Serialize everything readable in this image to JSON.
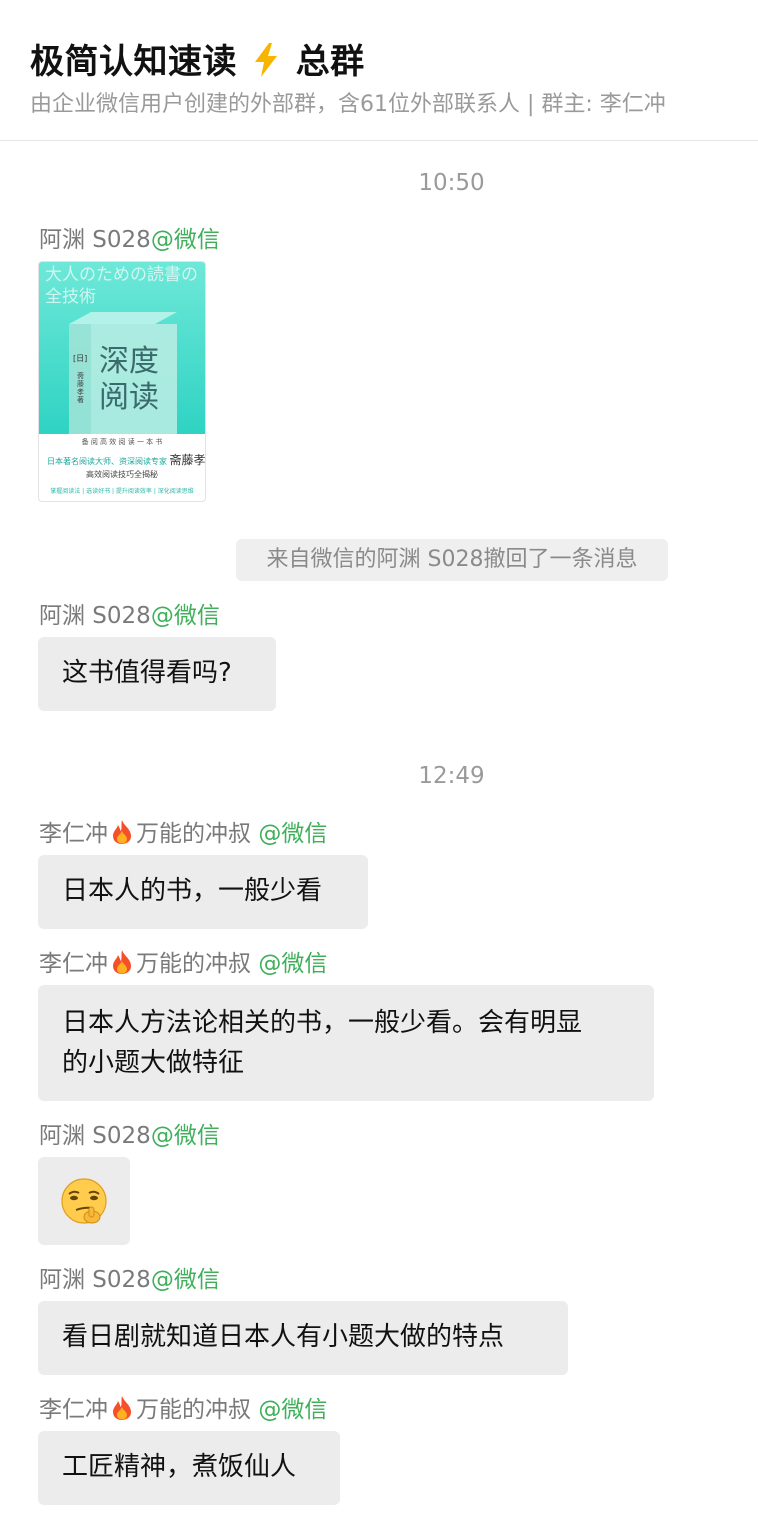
{
  "header": {
    "title": "极简认知速读",
    "title_suffix": "总群",
    "subtitle": "由企业微信用户创建的外部群，含61位外部联系人 | 群主: 李仁冲"
  },
  "times": [
    "10:50",
    "12:49"
  ],
  "names": {
    "ayuan": "阿渊 S028",
    "li": "李仁冲",
    "li_nick": "万能的冲叔",
    "wechat_tag": "@微信"
  },
  "book": {
    "cover_title_line1": "深度",
    "cover_title_line2": "阅读",
    "top_text": "大人のための読書の全技術",
    "country": "[日]",
    "author_small": "斋藤孝 著",
    "tagline": "备 阅 高 效 阅 读 一 本 书",
    "promo": "日本著名阅读大师、资深阅读专家",
    "author_name": "斋藤孝",
    "subtitle": "高效阅读技巧全揭秘",
    "footer": "掌握阅读法 | 选读好书 | 提升阅读效率 | 深化阅读思维"
  },
  "notice": "来自微信的阿渊 S028撤回了一条消息",
  "messages": {
    "m1": "这书值得看吗?",
    "m2": "日本人的书，一般少看",
    "m3_line1": "日本人方法论相关的书，一般少看。会有明显",
    "m3_line2": "的小题大做特征",
    "m5": "看日剧就知道日本人有小题大做的特点",
    "m6": "工匠精神，煮饭仙人"
  },
  "icons": {
    "lightning": "lightning-icon",
    "fire": "fire-icon",
    "emoji": "smirk-emoji-icon"
  },
  "colors": {
    "wechat_green": "#3faf5a",
    "bubble_bg": "#ececec",
    "book_accent": "#3fd6c4"
  }
}
